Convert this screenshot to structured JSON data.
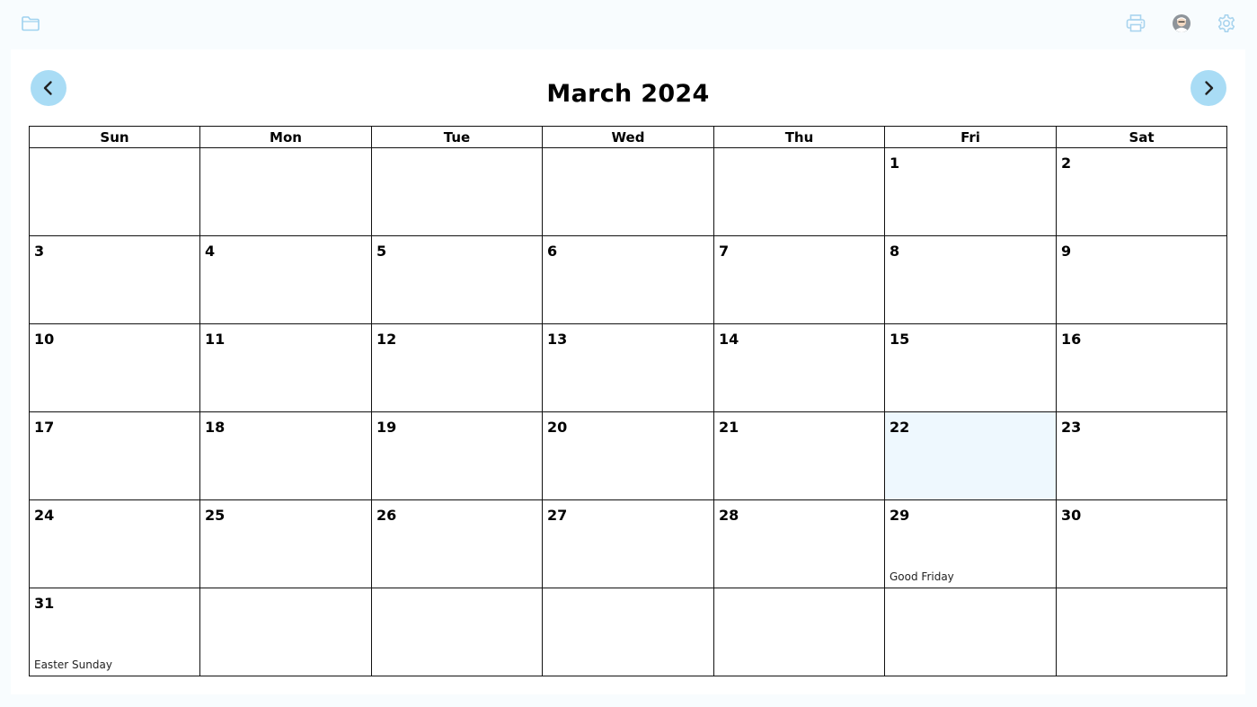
{
  "toolbar": {
    "icons": [
      "folder-icon",
      "printer-icon",
      "avatar",
      "gear-icon"
    ]
  },
  "calendar": {
    "title": "March 2024",
    "weekdays": [
      "Sun",
      "Mon",
      "Tue",
      "Wed",
      "Thu",
      "Fri",
      "Sat"
    ],
    "weeks": [
      [
        "",
        "",
        "",
        "",
        "",
        "1",
        "2"
      ],
      [
        "3",
        "4",
        "5",
        "6",
        "7",
        "8",
        "9"
      ],
      [
        "10",
        "11",
        "12",
        "13",
        "14",
        "15",
        "16"
      ],
      [
        "17",
        "18",
        "19",
        "20",
        "21",
        "22",
        "23"
      ],
      [
        "24",
        "25",
        "26",
        "27",
        "28",
        "29",
        "30"
      ],
      [
        "31",
        "",
        "",
        "",
        "",
        "",
        ""
      ]
    ],
    "highlighted_day": "22",
    "holidays": {
      "29": "Good Friday",
      "31": "Easter Sunday"
    }
  },
  "colors": {
    "accent": "#a9dcf5",
    "highlight": "#eef8fe",
    "icon": "#9fd2ef"
  }
}
